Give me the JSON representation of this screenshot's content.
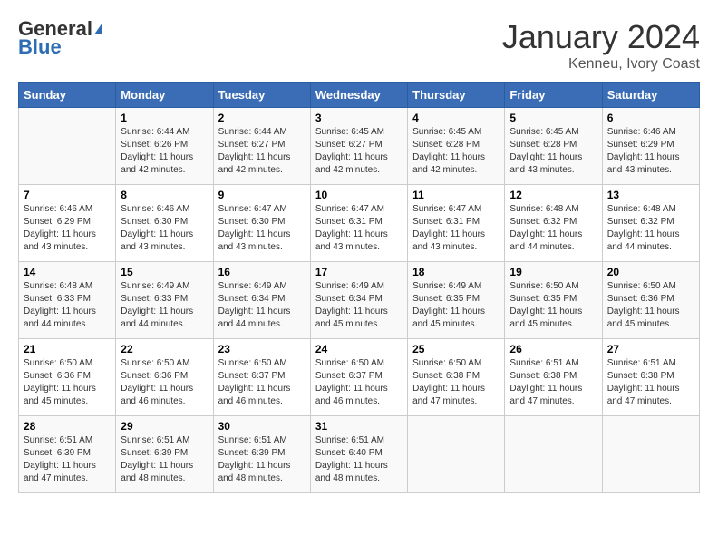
{
  "logo": {
    "general": "General",
    "blue": "Blue"
  },
  "title": "January 2024",
  "location": "Kenneu, Ivory Coast",
  "days_of_week": [
    "Sunday",
    "Monday",
    "Tuesday",
    "Wednesday",
    "Thursday",
    "Friday",
    "Saturday"
  ],
  "weeks": [
    [
      {
        "day": "",
        "sunrise": "",
        "sunset": "",
        "daylight": ""
      },
      {
        "day": "1",
        "sunrise": "Sunrise: 6:44 AM",
        "sunset": "Sunset: 6:26 PM",
        "daylight": "Daylight: 11 hours and 42 minutes."
      },
      {
        "day": "2",
        "sunrise": "Sunrise: 6:44 AM",
        "sunset": "Sunset: 6:27 PM",
        "daylight": "Daylight: 11 hours and 42 minutes."
      },
      {
        "day": "3",
        "sunrise": "Sunrise: 6:45 AM",
        "sunset": "Sunset: 6:27 PM",
        "daylight": "Daylight: 11 hours and 42 minutes."
      },
      {
        "day": "4",
        "sunrise": "Sunrise: 6:45 AM",
        "sunset": "Sunset: 6:28 PM",
        "daylight": "Daylight: 11 hours and 42 minutes."
      },
      {
        "day": "5",
        "sunrise": "Sunrise: 6:45 AM",
        "sunset": "Sunset: 6:28 PM",
        "daylight": "Daylight: 11 hours and 43 minutes."
      },
      {
        "day": "6",
        "sunrise": "Sunrise: 6:46 AM",
        "sunset": "Sunset: 6:29 PM",
        "daylight": "Daylight: 11 hours and 43 minutes."
      }
    ],
    [
      {
        "day": "7",
        "sunrise": "Sunrise: 6:46 AM",
        "sunset": "Sunset: 6:29 PM",
        "daylight": "Daylight: 11 hours and 43 minutes."
      },
      {
        "day": "8",
        "sunrise": "Sunrise: 6:46 AM",
        "sunset": "Sunset: 6:30 PM",
        "daylight": "Daylight: 11 hours and 43 minutes."
      },
      {
        "day": "9",
        "sunrise": "Sunrise: 6:47 AM",
        "sunset": "Sunset: 6:30 PM",
        "daylight": "Daylight: 11 hours and 43 minutes."
      },
      {
        "day": "10",
        "sunrise": "Sunrise: 6:47 AM",
        "sunset": "Sunset: 6:31 PM",
        "daylight": "Daylight: 11 hours and 43 minutes."
      },
      {
        "day": "11",
        "sunrise": "Sunrise: 6:47 AM",
        "sunset": "Sunset: 6:31 PM",
        "daylight": "Daylight: 11 hours and 43 minutes."
      },
      {
        "day": "12",
        "sunrise": "Sunrise: 6:48 AM",
        "sunset": "Sunset: 6:32 PM",
        "daylight": "Daylight: 11 hours and 44 minutes."
      },
      {
        "day": "13",
        "sunrise": "Sunrise: 6:48 AM",
        "sunset": "Sunset: 6:32 PM",
        "daylight": "Daylight: 11 hours and 44 minutes."
      }
    ],
    [
      {
        "day": "14",
        "sunrise": "Sunrise: 6:48 AM",
        "sunset": "Sunset: 6:33 PM",
        "daylight": "Daylight: 11 hours and 44 minutes."
      },
      {
        "day": "15",
        "sunrise": "Sunrise: 6:49 AM",
        "sunset": "Sunset: 6:33 PM",
        "daylight": "Daylight: 11 hours and 44 minutes."
      },
      {
        "day": "16",
        "sunrise": "Sunrise: 6:49 AM",
        "sunset": "Sunset: 6:34 PM",
        "daylight": "Daylight: 11 hours and 44 minutes."
      },
      {
        "day": "17",
        "sunrise": "Sunrise: 6:49 AM",
        "sunset": "Sunset: 6:34 PM",
        "daylight": "Daylight: 11 hours and 45 minutes."
      },
      {
        "day": "18",
        "sunrise": "Sunrise: 6:49 AM",
        "sunset": "Sunset: 6:35 PM",
        "daylight": "Daylight: 11 hours and 45 minutes."
      },
      {
        "day": "19",
        "sunrise": "Sunrise: 6:50 AM",
        "sunset": "Sunset: 6:35 PM",
        "daylight": "Daylight: 11 hours and 45 minutes."
      },
      {
        "day": "20",
        "sunrise": "Sunrise: 6:50 AM",
        "sunset": "Sunset: 6:36 PM",
        "daylight": "Daylight: 11 hours and 45 minutes."
      }
    ],
    [
      {
        "day": "21",
        "sunrise": "Sunrise: 6:50 AM",
        "sunset": "Sunset: 6:36 PM",
        "daylight": "Daylight: 11 hours and 45 minutes."
      },
      {
        "day": "22",
        "sunrise": "Sunrise: 6:50 AM",
        "sunset": "Sunset: 6:36 PM",
        "daylight": "Daylight: 11 hours and 46 minutes."
      },
      {
        "day": "23",
        "sunrise": "Sunrise: 6:50 AM",
        "sunset": "Sunset: 6:37 PM",
        "daylight": "Daylight: 11 hours and 46 minutes."
      },
      {
        "day": "24",
        "sunrise": "Sunrise: 6:50 AM",
        "sunset": "Sunset: 6:37 PM",
        "daylight": "Daylight: 11 hours and 46 minutes."
      },
      {
        "day": "25",
        "sunrise": "Sunrise: 6:50 AM",
        "sunset": "Sunset: 6:38 PM",
        "daylight": "Daylight: 11 hours and 47 minutes."
      },
      {
        "day": "26",
        "sunrise": "Sunrise: 6:51 AM",
        "sunset": "Sunset: 6:38 PM",
        "daylight": "Daylight: 11 hours and 47 minutes."
      },
      {
        "day": "27",
        "sunrise": "Sunrise: 6:51 AM",
        "sunset": "Sunset: 6:38 PM",
        "daylight": "Daylight: 11 hours and 47 minutes."
      }
    ],
    [
      {
        "day": "28",
        "sunrise": "Sunrise: 6:51 AM",
        "sunset": "Sunset: 6:39 PM",
        "daylight": "Daylight: 11 hours and 47 minutes."
      },
      {
        "day": "29",
        "sunrise": "Sunrise: 6:51 AM",
        "sunset": "Sunset: 6:39 PM",
        "daylight": "Daylight: 11 hours and 48 minutes."
      },
      {
        "day": "30",
        "sunrise": "Sunrise: 6:51 AM",
        "sunset": "Sunset: 6:39 PM",
        "daylight": "Daylight: 11 hours and 48 minutes."
      },
      {
        "day": "31",
        "sunrise": "Sunrise: 6:51 AM",
        "sunset": "Sunset: 6:40 PM",
        "daylight": "Daylight: 11 hours and 48 minutes."
      },
      {
        "day": "",
        "sunrise": "",
        "sunset": "",
        "daylight": ""
      },
      {
        "day": "",
        "sunrise": "",
        "sunset": "",
        "daylight": ""
      },
      {
        "day": "",
        "sunrise": "",
        "sunset": "",
        "daylight": ""
      }
    ]
  ]
}
